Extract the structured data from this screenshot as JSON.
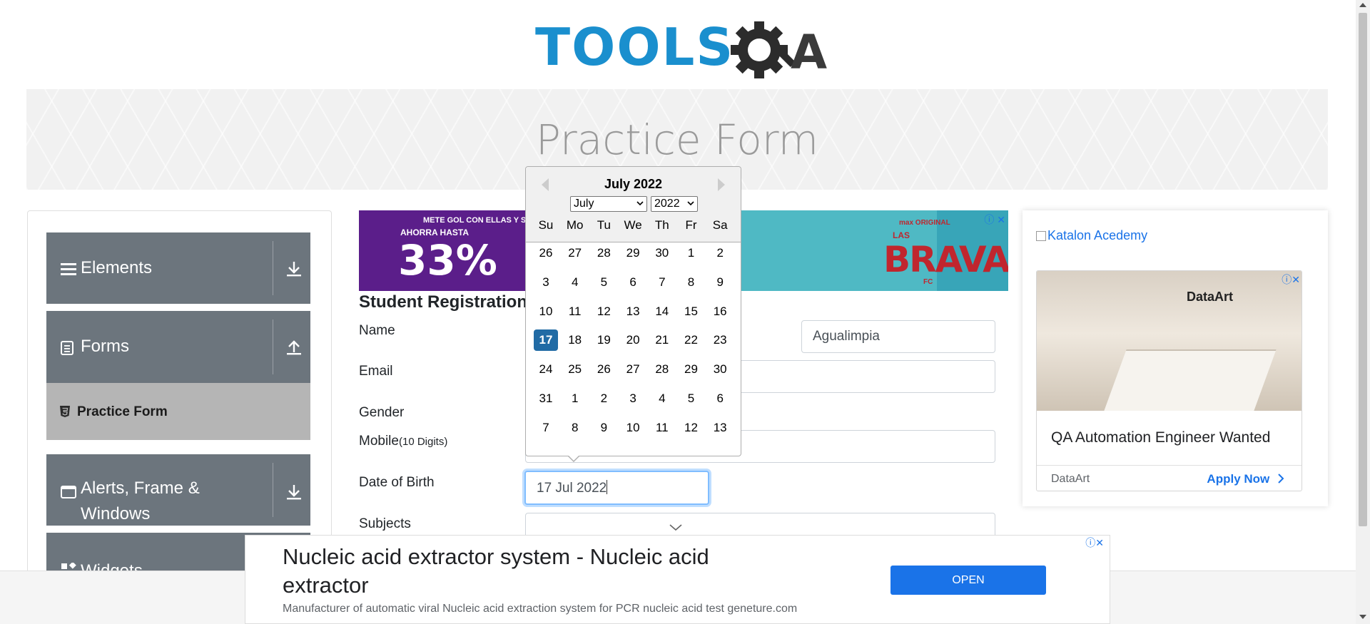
{
  "logo": {
    "text": "TOOLS",
    "suffix": "A"
  },
  "page": {
    "title": "Practice Form"
  },
  "sidebar": {
    "groups": [
      {
        "label": "Elements",
        "icon": "hamburger-icon",
        "arrow": "download-icon"
      },
      {
        "label": "Forms",
        "icon": "document-icon",
        "arrow": "upload-icon"
      },
      {
        "label": "Alerts, Frame &",
        "label2": "Windows",
        "icon": "window-icon",
        "arrow": "download-icon"
      },
      {
        "label": "Widgets",
        "icon": "widgets-icon"
      }
    ],
    "active_item": {
      "label": "Practice Form",
      "icon": "html5-icon"
    }
  },
  "ad_top": {
    "left_small1": "METE GOL CON ELLAS Y SE",
    "left_small2": "AHORRA HASTA",
    "left_pct": "33%",
    "badge": "max ORIGINAL",
    "las": "LAS",
    "brand": "BRAVAS",
    "fc": "FC",
    "close": "ⓘ ✕"
  },
  "form": {
    "heading": "Student Registration",
    "labels": {
      "name": "Name",
      "email": "Email",
      "gender": "Gender",
      "mobile": "Mobile",
      "mobile_hint": "(10 Digits)",
      "dob": "Date of Birth",
      "subjects": "Subjects"
    },
    "last_name_value": "Agualimpia",
    "dob_value": "17 Jul 2022"
  },
  "datepicker": {
    "title": "July 2022",
    "month_select": "July",
    "year_select": "2022",
    "weekdays": [
      "Su",
      "Mo",
      "Tu",
      "We",
      "Th",
      "Fr",
      "Sa"
    ],
    "weeks": [
      [
        "26",
        "27",
        "28",
        "29",
        "30",
        "1",
        "2"
      ],
      [
        "3",
        "4",
        "5",
        "6",
        "7",
        "8",
        "9"
      ],
      [
        "10",
        "11",
        "12",
        "13",
        "14",
        "15",
        "16"
      ],
      [
        "17",
        "18",
        "19",
        "20",
        "21",
        "22",
        "23"
      ],
      [
        "24",
        "25",
        "26",
        "27",
        "28",
        "29",
        "30"
      ],
      [
        "31",
        "1",
        "2",
        "3",
        "4",
        "5",
        "6"
      ],
      [
        "7",
        "8",
        "9",
        "10",
        "11",
        "12",
        "13"
      ]
    ],
    "selected": "17"
  },
  "ad_right": {
    "katalon": "Katalon Acedemy",
    "photo_logo": "DataArt",
    "headline": "QA Automation Engineer Wanted",
    "brand": "DataArt",
    "apply": "Apply Now",
    "close": "ⓘ✕"
  },
  "ad_bottom": {
    "headline": "Nucleic acid extractor system - Nucleic acid extractor",
    "description": "Manufacturer of automatic viral Nucleic acid extraction system for PCR nucleic acid test geneture.com",
    "button": "OPEN",
    "close": "ⓘ✕"
  }
}
